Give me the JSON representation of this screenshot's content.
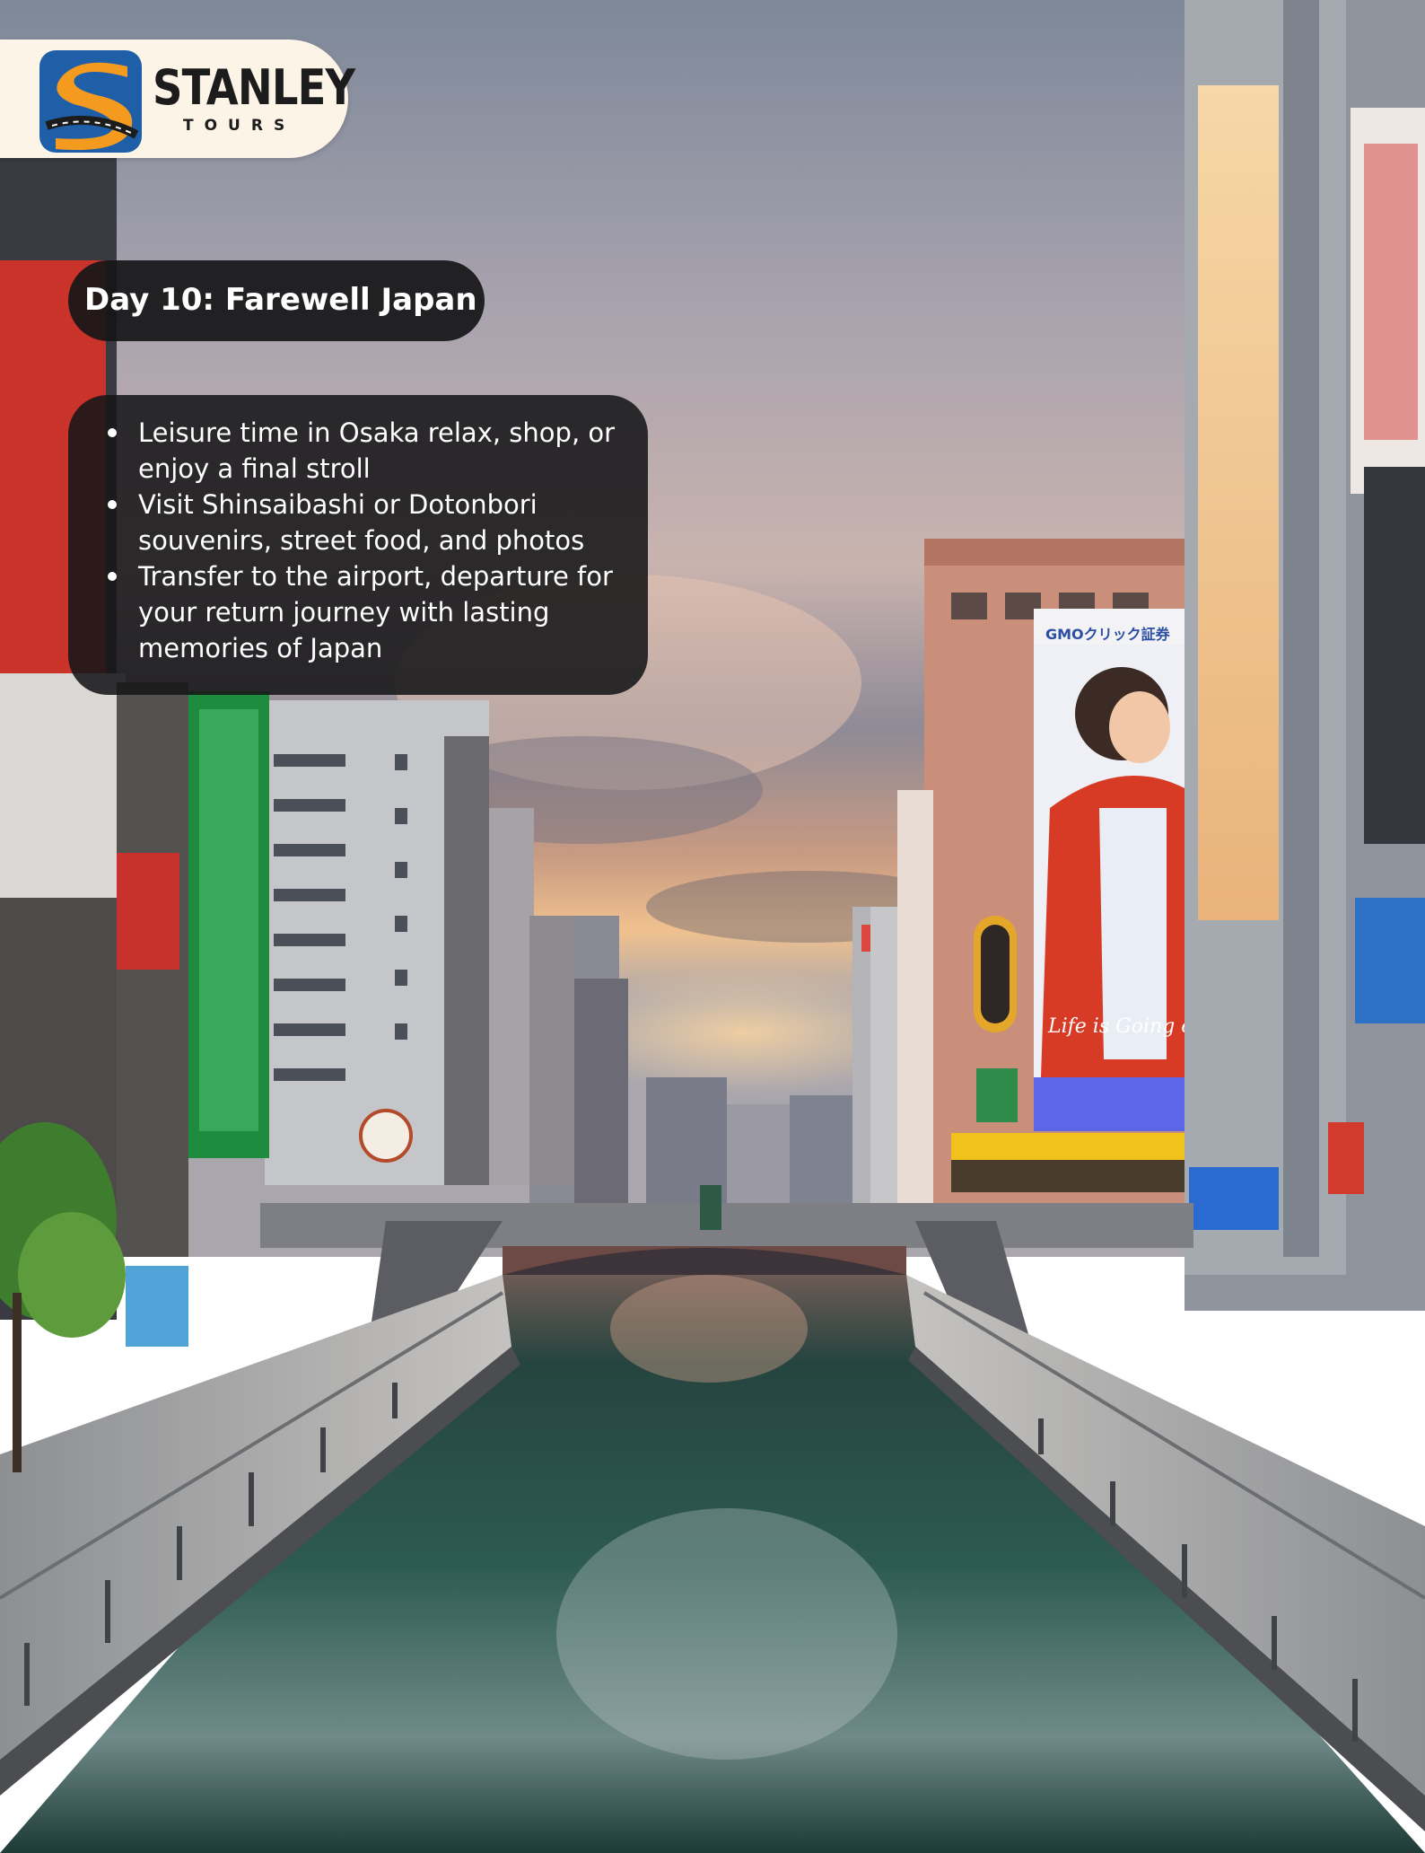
{
  "logo": {
    "name": "STANLEY",
    "tagline": "TOURS",
    "colors": {
      "orange": "#f39a1f",
      "blue": "#1f5fa8",
      "cream": "#fdf4e8"
    }
  },
  "photo": {
    "billboard_text": "Life is Going on"
  },
  "day": {
    "title": "Day 10: Farewell Japan",
    "bullets": [
      "Leisure time in Osaka  relax, shop, or enjoy a final stroll",
      "Visit Shinsaibashi or Dotonbori souvenirs, street food, and photos",
      "Transfer to the airport, departure for your return journey with lasting memories of Japan"
    ]
  }
}
